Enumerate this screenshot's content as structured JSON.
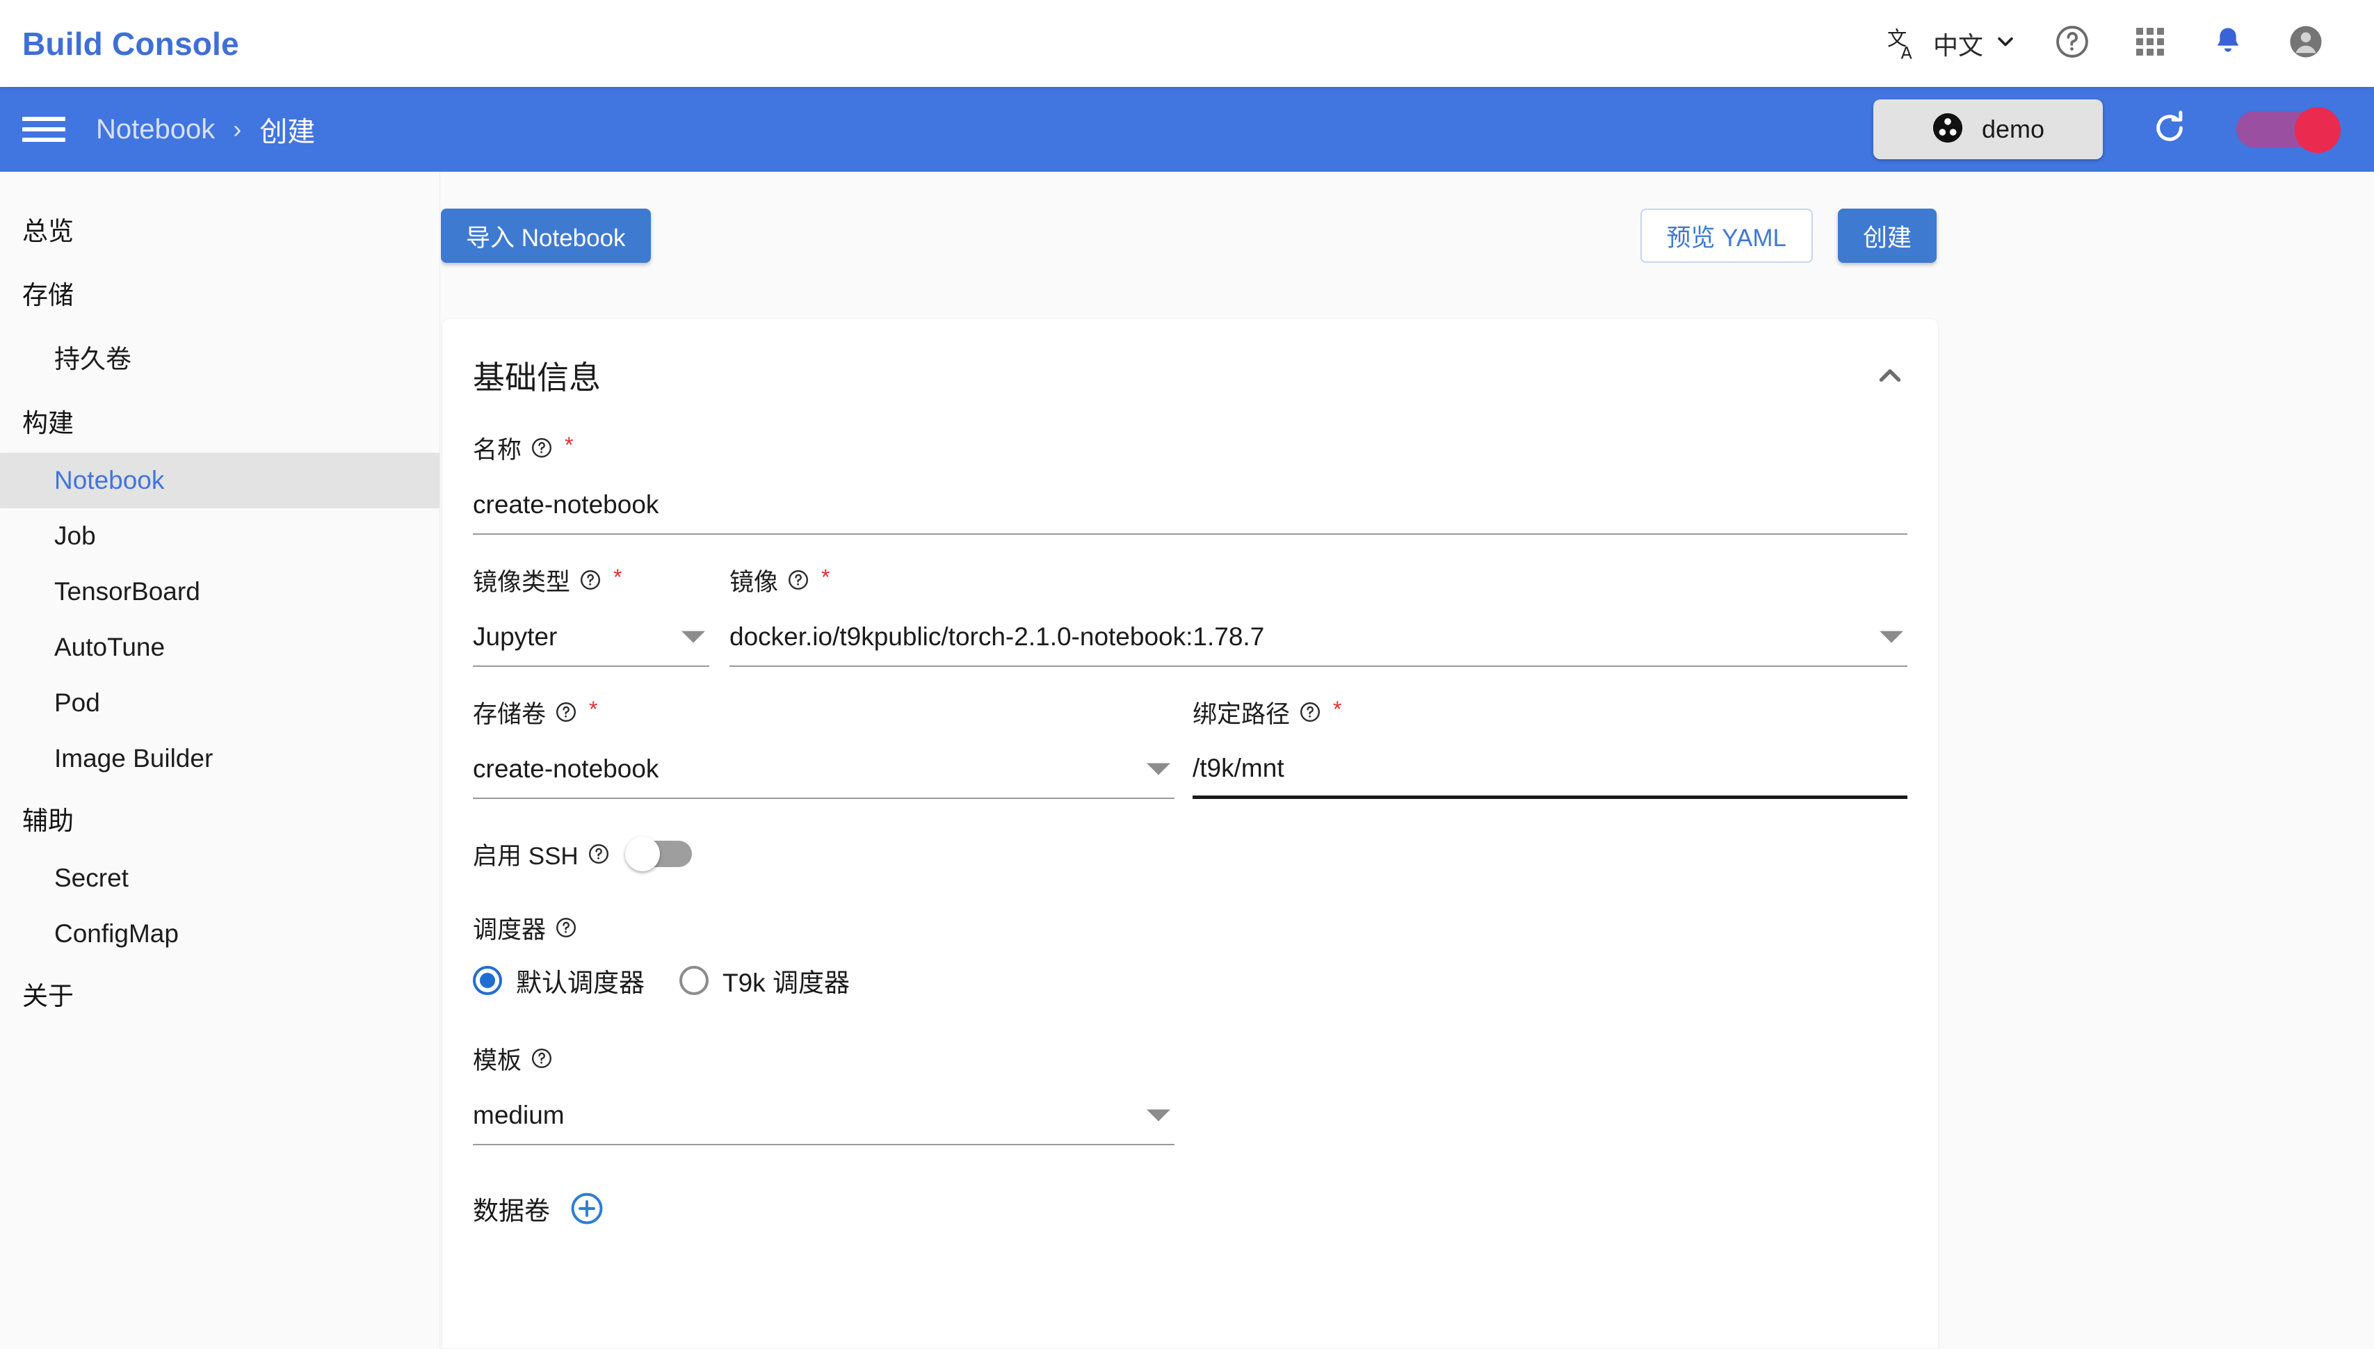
{
  "header": {
    "brand": "Build Console",
    "language": "中文",
    "icons": {
      "translate": "translate-icon",
      "chevron": "chevron-down-icon",
      "help": "help-circle-icon",
      "apps": "apps-grid-icon",
      "notifications": "bell-icon",
      "account": "account-circle-icon"
    }
  },
  "navbar": {
    "menu_icon": "hamburger-menu-icon",
    "breadcrumb": {
      "parent": "Notebook",
      "separator": "›",
      "current": "创建"
    },
    "namespace_chip": {
      "label": "demo",
      "icon": "namespace-icon"
    },
    "refresh_icon": "refresh-icon",
    "theme_toggle": {
      "track_color": "#9b4fa0",
      "knob_color": "#ea2a4e"
    }
  },
  "sidebar": {
    "items": [
      {
        "label": "总览",
        "type": "group",
        "active": false
      },
      {
        "label": "存储",
        "type": "group",
        "active": false
      },
      {
        "label": "持久卷",
        "type": "item",
        "active": false
      },
      {
        "label": "构建",
        "type": "group",
        "active": false
      },
      {
        "label": "Notebook",
        "type": "item",
        "active": true
      },
      {
        "label": "Job",
        "type": "item",
        "active": false
      },
      {
        "label": "TensorBoard",
        "type": "item",
        "active": false
      },
      {
        "label": "AutoTune",
        "type": "item",
        "active": false
      },
      {
        "label": "Pod",
        "type": "item",
        "active": false
      },
      {
        "label": "Image Builder",
        "type": "item",
        "active": false
      },
      {
        "label": "辅助",
        "type": "group",
        "active": false
      },
      {
        "label": "Secret",
        "type": "item",
        "active": false
      },
      {
        "label": "ConfigMap",
        "type": "item",
        "active": false
      },
      {
        "label": "关于",
        "type": "group",
        "active": false
      }
    ]
  },
  "toolbar": {
    "import_label": "导入 Notebook",
    "preview_yaml_label": "预览 YAML",
    "create_label": "创建"
  },
  "card": {
    "title": "基础信息",
    "collapse_icon": "chevron-up-icon",
    "fields": {
      "name": {
        "label": "名称",
        "help_icon": "help-circle-icon",
        "required": "*",
        "value": "create-notebook"
      },
      "image_type": {
        "label": "镜像类型",
        "help_icon": "help-circle-icon",
        "required": "*",
        "value": "Jupyter",
        "arrow_icon": "dropdown-arrow-icon"
      },
      "image": {
        "label": "镜像",
        "help_icon": "help-circle-icon",
        "required": "*",
        "value": "docker.io/t9kpublic/torch-2.1.0-notebook:1.78.7",
        "arrow_icon": "dropdown-arrow-icon"
      },
      "storage_volume": {
        "label": "存储卷",
        "help_icon": "help-circle-icon",
        "required": "*",
        "value": "create-notebook",
        "arrow_icon": "dropdown-arrow-icon"
      },
      "bind_path": {
        "label": "绑定路径",
        "help_icon": "help-circle-icon",
        "required": "*",
        "value": "/t9k/mnt",
        "focused": true
      },
      "enable_ssh": {
        "label": "启用 SSH",
        "help_icon": "help-circle-icon",
        "checked": false
      },
      "scheduler": {
        "label": "调度器",
        "help_icon": "help-circle-icon",
        "options": [
          {
            "label": "默认调度器",
            "checked": true
          },
          {
            "label": "T9k 调度器",
            "checked": false
          }
        ]
      },
      "template": {
        "label": "模板",
        "help_icon": "help-circle-icon",
        "value": "medium",
        "arrow_icon": "dropdown-arrow-icon"
      },
      "data_volume": {
        "label": "数据卷",
        "add_icon": "add-circle-icon"
      }
    }
  },
  "colors": {
    "brand_blue": "#3f6fd8",
    "nav_blue": "#4175df",
    "accent_blue": "#3f7ad1",
    "required_red": "#e03131",
    "active_item_bg": "#e3e3e3"
  }
}
